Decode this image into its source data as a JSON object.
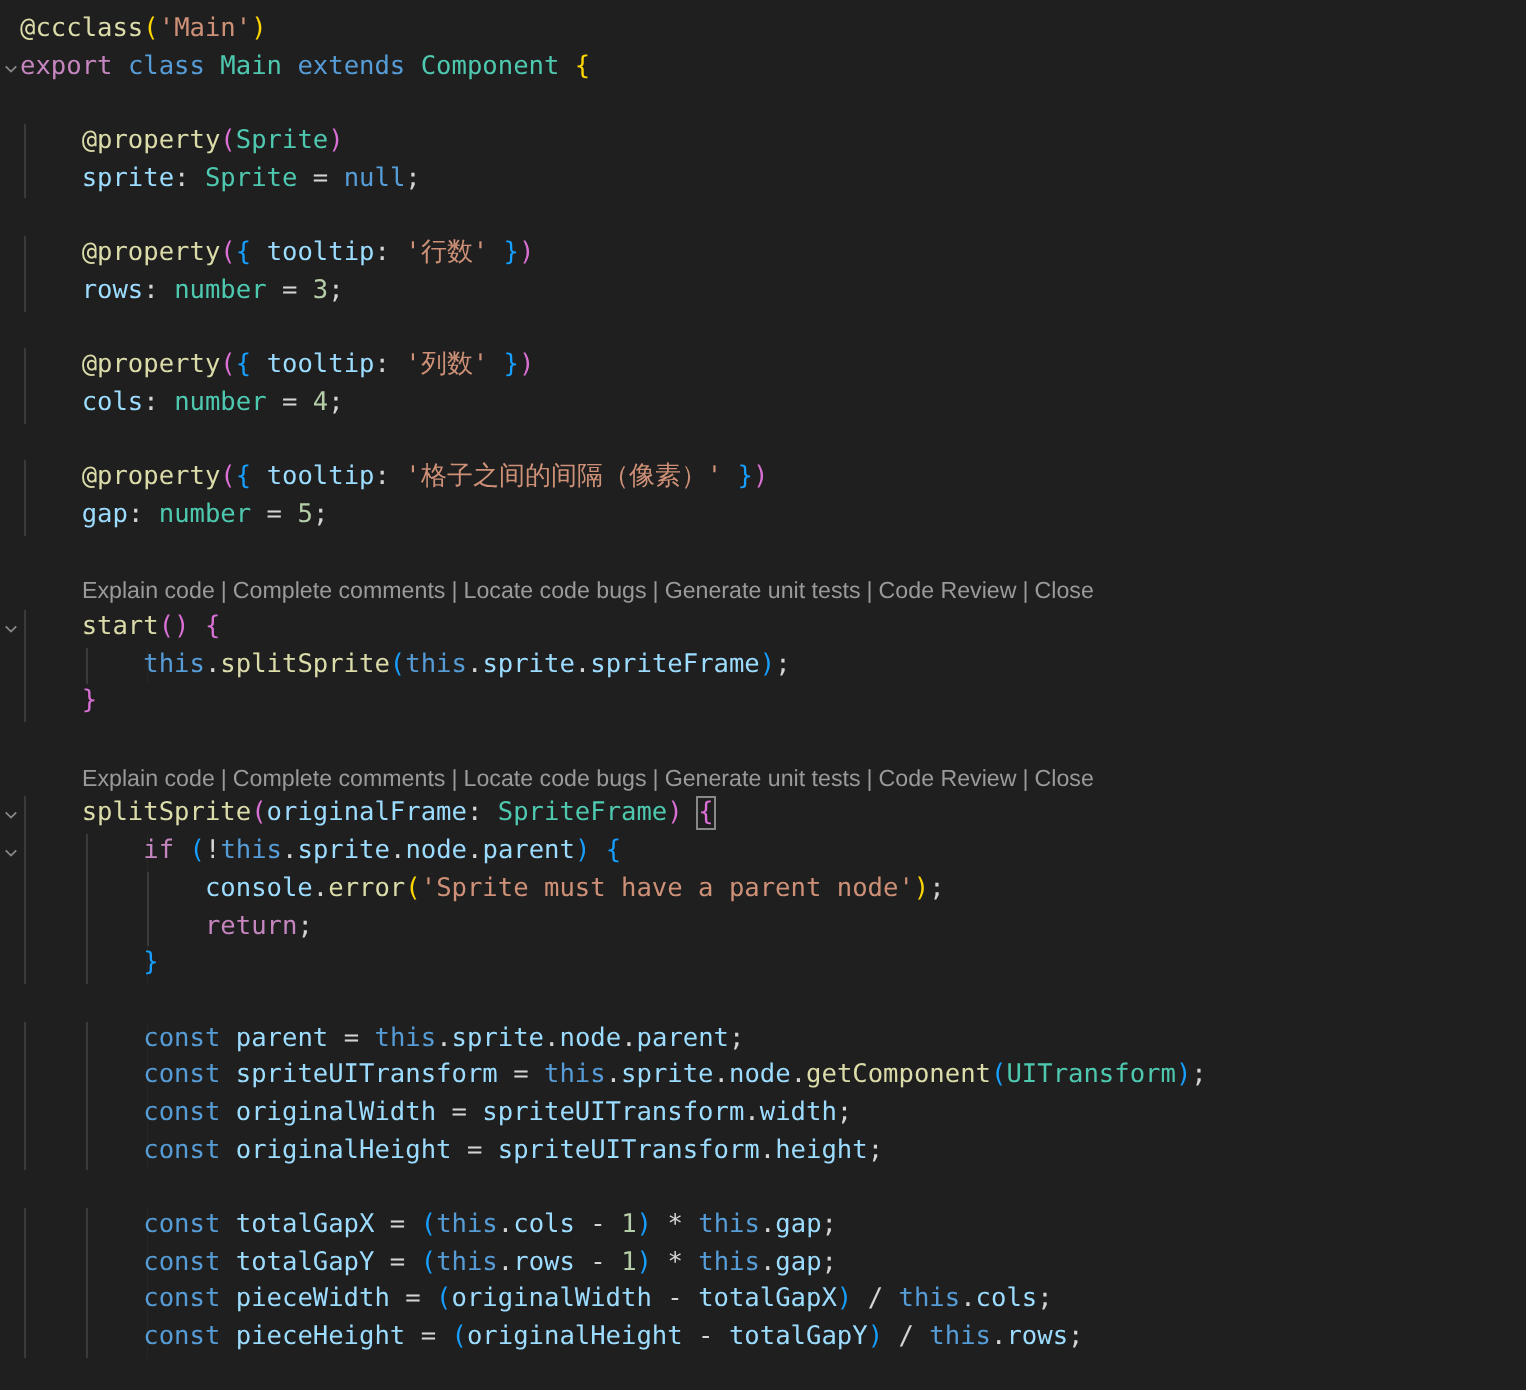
{
  "editor": {
    "lines": [
      {
        "kind": "code",
        "fold": false,
        "tokens": [
          {
            "kind": "fn",
            "text": "@ccclass"
          },
          {
            "kind": "b1",
            "text": "("
          },
          {
            "kind": "str",
            "text": "'Main'"
          },
          {
            "kind": "b1",
            "text": ")"
          }
        ]
      },
      {
        "kind": "code",
        "fold": true,
        "tokens": [
          {
            "kind": "ctl",
            "text": "export "
          },
          {
            "kind": "kw",
            "text": "class "
          },
          {
            "kind": "type",
            "text": "Main "
          },
          {
            "kind": "kw",
            "text": "extends "
          },
          {
            "kind": "type",
            "text": "Component "
          },
          {
            "kind": "b1",
            "text": "{"
          }
        ]
      },
      {
        "kind": "blank"
      },
      {
        "kind": "code",
        "fold": false,
        "tokens": [
          {
            "kind": "fn",
            "text": "    @property"
          },
          {
            "kind": "b2",
            "text": "("
          },
          {
            "kind": "type",
            "text": "Sprite"
          },
          {
            "kind": "b2",
            "text": ")"
          }
        ]
      },
      {
        "kind": "code",
        "fold": false,
        "tokens": [
          {
            "kind": "var",
            "text": "    sprite"
          },
          {
            "kind": "p",
            "text": ": "
          },
          {
            "kind": "type",
            "text": "Sprite"
          },
          {
            "kind": "p",
            "text": " = "
          },
          {
            "kind": "kw",
            "text": "null"
          },
          {
            "kind": "p",
            "text": ";"
          }
        ]
      },
      {
        "kind": "blank"
      },
      {
        "kind": "code",
        "fold": false,
        "tokens": [
          {
            "kind": "fn",
            "text": "    @property"
          },
          {
            "kind": "b2",
            "text": "("
          },
          {
            "kind": "b3",
            "text": "{"
          },
          {
            "kind": "var",
            "text": " tooltip"
          },
          {
            "kind": "p",
            "text": ": "
          },
          {
            "kind": "str",
            "text": "'行数'"
          },
          {
            "kind": "b3",
            "text": " }"
          },
          {
            "kind": "b2",
            "text": ")"
          }
        ]
      },
      {
        "kind": "code",
        "fold": false,
        "tokens": [
          {
            "kind": "var",
            "text": "    rows"
          },
          {
            "kind": "p",
            "text": ": "
          },
          {
            "kind": "type",
            "text": "number"
          },
          {
            "kind": "p",
            "text": " = "
          },
          {
            "kind": "num",
            "text": "3"
          },
          {
            "kind": "p",
            "text": ";"
          }
        ]
      },
      {
        "kind": "blank"
      },
      {
        "kind": "code",
        "fold": false,
        "tokens": [
          {
            "kind": "fn",
            "text": "    @property"
          },
          {
            "kind": "b2",
            "text": "("
          },
          {
            "kind": "b3",
            "text": "{"
          },
          {
            "kind": "var",
            "text": " tooltip"
          },
          {
            "kind": "p",
            "text": ": "
          },
          {
            "kind": "str",
            "text": "'列数'"
          },
          {
            "kind": "b3",
            "text": " }"
          },
          {
            "kind": "b2",
            "text": ")"
          }
        ]
      },
      {
        "kind": "code",
        "fold": false,
        "tokens": [
          {
            "kind": "var",
            "text": "    cols"
          },
          {
            "kind": "p",
            "text": ": "
          },
          {
            "kind": "type",
            "text": "number"
          },
          {
            "kind": "p",
            "text": " = "
          },
          {
            "kind": "num",
            "text": "4"
          },
          {
            "kind": "p",
            "text": ";"
          }
        ]
      },
      {
        "kind": "blank"
      },
      {
        "kind": "code",
        "fold": false,
        "tokens": [
          {
            "kind": "fn",
            "text": "    @property"
          },
          {
            "kind": "b2",
            "text": "("
          },
          {
            "kind": "b3",
            "text": "{"
          },
          {
            "kind": "var",
            "text": " tooltip"
          },
          {
            "kind": "p",
            "text": ": "
          },
          {
            "kind": "str",
            "text": "'格子之间的间隔（像素）'"
          },
          {
            "kind": "b3",
            "text": " }"
          },
          {
            "kind": "b2",
            "text": ")"
          }
        ]
      },
      {
        "kind": "code",
        "fold": false,
        "tokens": [
          {
            "kind": "var",
            "text": "    gap"
          },
          {
            "kind": "p",
            "text": ": "
          },
          {
            "kind": "type",
            "text": "number"
          },
          {
            "kind": "p",
            "text": " = "
          },
          {
            "kind": "num",
            "text": "5"
          },
          {
            "kind": "p",
            "text": ";"
          }
        ]
      },
      {
        "kind": "blank"
      },
      {
        "kind": "lens",
        "separator": "|",
        "actions": [
          "Explain code",
          "Complete comments",
          "Locate code bugs",
          "Generate unit tests",
          "Code Review",
          "Close"
        ]
      },
      {
        "kind": "code",
        "fold": true,
        "tokens": [
          {
            "kind": "fn",
            "text": "    start"
          },
          {
            "kind": "b2",
            "text": "()"
          },
          {
            "kind": "b2",
            "text": " {"
          }
        ]
      },
      {
        "kind": "code",
        "fold": false,
        "tokens": [
          {
            "kind": "kw",
            "text": "        this"
          },
          {
            "kind": "p",
            "text": "."
          },
          {
            "kind": "fn",
            "text": "splitSprite"
          },
          {
            "kind": "b3",
            "text": "("
          },
          {
            "kind": "kw",
            "text": "this"
          },
          {
            "kind": "p",
            "text": "."
          },
          {
            "kind": "var",
            "text": "sprite"
          },
          {
            "kind": "p",
            "text": "."
          },
          {
            "kind": "var",
            "text": "spriteFrame"
          },
          {
            "kind": "b3",
            "text": ")"
          },
          {
            "kind": "p",
            "text": ";"
          }
        ]
      },
      {
        "kind": "code",
        "fold": false,
        "tokens": [
          {
            "kind": "b2",
            "text": "    }"
          }
        ]
      },
      {
        "kind": "blank"
      },
      {
        "kind": "lens",
        "separator": "|",
        "actions": [
          "Explain code",
          "Complete comments",
          "Locate code bugs",
          "Generate unit tests",
          "Code Review",
          "Close"
        ]
      },
      {
        "kind": "code",
        "fold": true,
        "tokens": [
          {
            "kind": "fn",
            "text": "    splitSprite"
          },
          {
            "kind": "b2",
            "text": "("
          },
          {
            "kind": "var",
            "text": "originalFrame"
          },
          {
            "kind": "p",
            "text": ": "
          },
          {
            "kind": "type",
            "text": "SpriteFrame"
          },
          {
            "kind": "b2",
            "text": ") "
          },
          {
            "kind": "b2",
            "text": "{",
            "matched": true
          }
        ]
      },
      {
        "kind": "code",
        "fold": true,
        "tokens": [
          {
            "kind": "ctl",
            "text": "        if "
          },
          {
            "kind": "b3",
            "text": "("
          },
          {
            "kind": "p",
            "text": "!"
          },
          {
            "kind": "kw",
            "text": "this"
          },
          {
            "kind": "p",
            "text": "."
          },
          {
            "kind": "var",
            "text": "sprite"
          },
          {
            "kind": "p",
            "text": "."
          },
          {
            "kind": "var",
            "text": "node"
          },
          {
            "kind": "p",
            "text": "."
          },
          {
            "kind": "var",
            "text": "parent"
          },
          {
            "kind": "b3",
            "text": ")"
          },
          {
            "kind": "b3",
            "text": " {"
          }
        ]
      },
      {
        "kind": "code",
        "fold": false,
        "tokens": [
          {
            "kind": "var",
            "text": "            console"
          },
          {
            "kind": "p",
            "text": "."
          },
          {
            "kind": "fn",
            "text": "error"
          },
          {
            "kind": "b1",
            "text": "("
          },
          {
            "kind": "str",
            "text": "'Sprite must have a parent node'"
          },
          {
            "kind": "b1",
            "text": ")"
          },
          {
            "kind": "p",
            "text": ";"
          }
        ]
      },
      {
        "kind": "code",
        "fold": false,
        "tokens": [
          {
            "kind": "ctl",
            "text": "            return"
          },
          {
            "kind": "p",
            "text": ";"
          }
        ]
      },
      {
        "kind": "code",
        "fold": false,
        "tokens": [
          {
            "kind": "b3",
            "text": "        }"
          }
        ]
      },
      {
        "kind": "blank"
      },
      {
        "kind": "code",
        "fold": false,
        "tokens": [
          {
            "kind": "kw",
            "text": "        const "
          },
          {
            "kind": "var",
            "text": "parent"
          },
          {
            "kind": "p",
            "text": " = "
          },
          {
            "kind": "kw",
            "text": "this"
          },
          {
            "kind": "p",
            "text": "."
          },
          {
            "kind": "var",
            "text": "sprite"
          },
          {
            "kind": "p",
            "text": "."
          },
          {
            "kind": "var",
            "text": "node"
          },
          {
            "kind": "p",
            "text": "."
          },
          {
            "kind": "var",
            "text": "parent"
          },
          {
            "kind": "p",
            "text": ";"
          }
        ]
      },
      {
        "kind": "code",
        "fold": false,
        "tokens": [
          {
            "kind": "kw",
            "text": "        const "
          },
          {
            "kind": "var",
            "text": "spriteUITransform"
          },
          {
            "kind": "p",
            "text": " = "
          },
          {
            "kind": "kw",
            "text": "this"
          },
          {
            "kind": "p",
            "text": "."
          },
          {
            "kind": "var",
            "text": "sprite"
          },
          {
            "kind": "p",
            "text": "."
          },
          {
            "kind": "var",
            "text": "node"
          },
          {
            "kind": "p",
            "text": "."
          },
          {
            "kind": "fn",
            "text": "getComponent"
          },
          {
            "kind": "b3",
            "text": "("
          },
          {
            "kind": "type",
            "text": "UITransform"
          },
          {
            "kind": "b3",
            "text": ")"
          },
          {
            "kind": "p",
            "text": ";"
          }
        ]
      },
      {
        "kind": "code",
        "fold": false,
        "tokens": [
          {
            "kind": "kw",
            "text": "        const "
          },
          {
            "kind": "var",
            "text": "originalWidth"
          },
          {
            "kind": "p",
            "text": " = "
          },
          {
            "kind": "var",
            "text": "spriteUITransform"
          },
          {
            "kind": "p",
            "text": "."
          },
          {
            "kind": "var",
            "text": "width"
          },
          {
            "kind": "p",
            "text": ";"
          }
        ]
      },
      {
        "kind": "code",
        "fold": false,
        "tokens": [
          {
            "kind": "kw",
            "text": "        const "
          },
          {
            "kind": "var",
            "text": "originalHeight"
          },
          {
            "kind": "p",
            "text": " = "
          },
          {
            "kind": "var",
            "text": "spriteUITransform"
          },
          {
            "kind": "p",
            "text": "."
          },
          {
            "kind": "var",
            "text": "height"
          },
          {
            "kind": "p",
            "text": ";"
          }
        ]
      },
      {
        "kind": "blank"
      },
      {
        "kind": "code",
        "fold": false,
        "tokens": [
          {
            "kind": "kw",
            "text": "        const "
          },
          {
            "kind": "var",
            "text": "totalGapX"
          },
          {
            "kind": "p",
            "text": " = "
          },
          {
            "kind": "b3",
            "text": "("
          },
          {
            "kind": "kw",
            "text": "this"
          },
          {
            "kind": "p",
            "text": "."
          },
          {
            "kind": "var",
            "text": "cols"
          },
          {
            "kind": "p",
            "text": " - "
          },
          {
            "kind": "num",
            "text": "1"
          },
          {
            "kind": "b3",
            "text": ")"
          },
          {
            "kind": "p",
            "text": " * "
          },
          {
            "kind": "kw",
            "text": "this"
          },
          {
            "kind": "p",
            "text": "."
          },
          {
            "kind": "var",
            "text": "gap"
          },
          {
            "kind": "p",
            "text": ";"
          }
        ]
      },
      {
        "kind": "code",
        "fold": false,
        "tokens": [
          {
            "kind": "kw",
            "text": "        const "
          },
          {
            "kind": "var",
            "text": "totalGapY"
          },
          {
            "kind": "p",
            "text": " = "
          },
          {
            "kind": "b3",
            "text": "("
          },
          {
            "kind": "kw",
            "text": "this"
          },
          {
            "kind": "p",
            "text": "."
          },
          {
            "kind": "var",
            "text": "rows"
          },
          {
            "kind": "p",
            "text": " - "
          },
          {
            "kind": "num",
            "text": "1"
          },
          {
            "kind": "b3",
            "text": ")"
          },
          {
            "kind": "p",
            "text": " * "
          },
          {
            "kind": "kw",
            "text": "this"
          },
          {
            "kind": "p",
            "text": "."
          },
          {
            "kind": "var",
            "text": "gap"
          },
          {
            "kind": "p",
            "text": ";"
          }
        ]
      },
      {
        "kind": "code",
        "fold": false,
        "tokens": [
          {
            "kind": "kw",
            "text": "        const "
          },
          {
            "kind": "var",
            "text": "pieceWidth"
          },
          {
            "kind": "p",
            "text": " = "
          },
          {
            "kind": "b3",
            "text": "("
          },
          {
            "kind": "var",
            "text": "originalWidth"
          },
          {
            "kind": "p",
            "text": " - "
          },
          {
            "kind": "var",
            "text": "totalGapX"
          },
          {
            "kind": "b3",
            "text": ")"
          },
          {
            "kind": "p",
            "text": " / "
          },
          {
            "kind": "kw",
            "text": "this"
          },
          {
            "kind": "p",
            "text": "."
          },
          {
            "kind": "var",
            "text": "cols"
          },
          {
            "kind": "p",
            "text": ";"
          }
        ]
      },
      {
        "kind": "code",
        "fold": false,
        "tokens": [
          {
            "kind": "kw",
            "text": "        const "
          },
          {
            "kind": "var",
            "text": "pieceHeight"
          },
          {
            "kind": "p",
            "text": " = "
          },
          {
            "kind": "b3",
            "text": "("
          },
          {
            "kind": "var",
            "text": "originalHeight"
          },
          {
            "kind": "p",
            "text": " - "
          },
          {
            "kind": "var",
            "text": "totalGapY"
          },
          {
            "kind": "b3",
            "text": ")"
          },
          {
            "kind": "p",
            "text": " / "
          },
          {
            "kind": "kw",
            "text": "this"
          },
          {
            "kind": "p",
            "text": "."
          },
          {
            "kind": "var",
            "text": "rows"
          },
          {
            "kind": "p",
            "text": ";"
          }
        ]
      }
    ]
  }
}
